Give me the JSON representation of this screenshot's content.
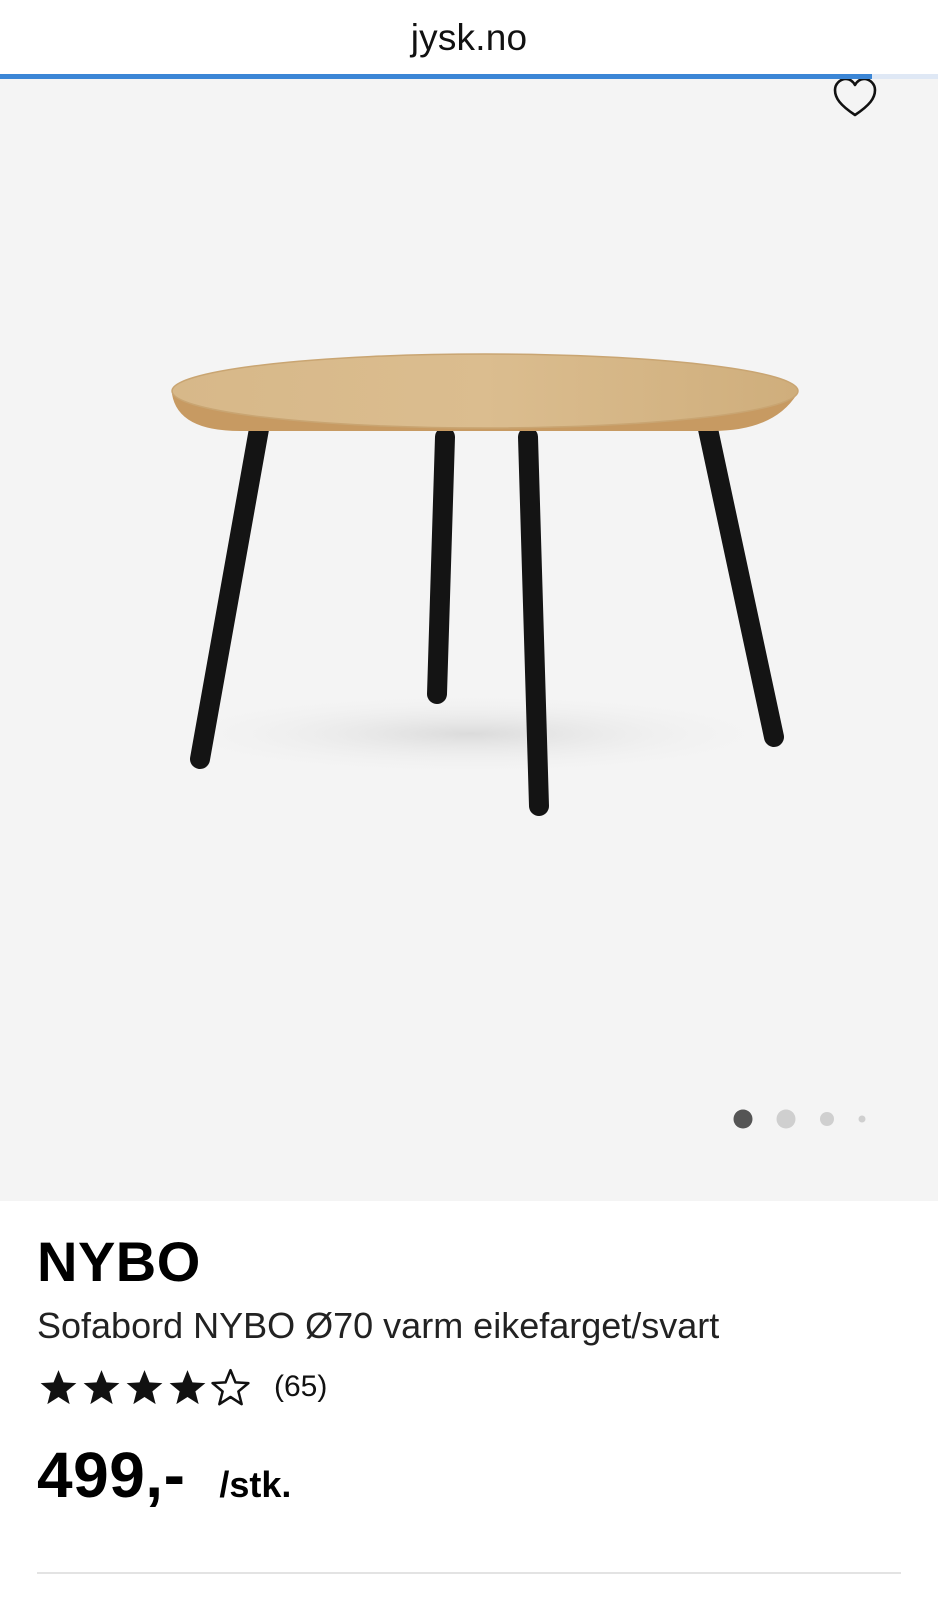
{
  "browser": {
    "url": "jysk.no",
    "load_progress": 0.93
  },
  "gallery": {
    "image_count": 4,
    "active_index": 0,
    "favorite_icon": "heart-outline-icon"
  },
  "product": {
    "brand": "NYBO",
    "subtitle": "Sofabord NYBO Ø70 varm eikefarget/svart",
    "rating": {
      "value": 4.5,
      "max": 5,
      "count_text": "(65)"
    },
    "price": "499,-",
    "unit": "/stk."
  },
  "colors": {
    "progress_blue": "#3b86d6",
    "gallery_bg": "#f4f4f4",
    "tabletop_oak": "#d2b07e",
    "legs_black": "#141414"
  }
}
